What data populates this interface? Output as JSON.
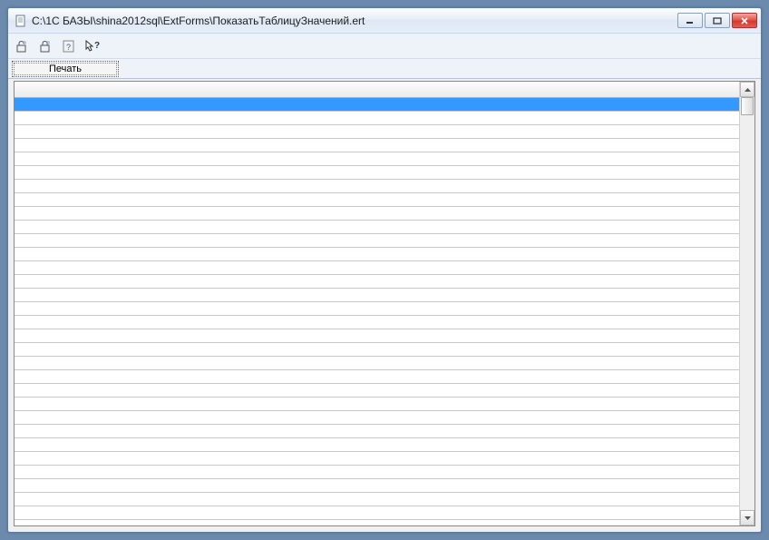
{
  "window": {
    "title": "C:\\1С БАЗЫ\\shina2012sql\\ExtForms\\ПоказатьТаблицуЗначений.ert"
  },
  "toolbar": {
    "print_label": "Печать"
  },
  "grid": {
    "row_count": 31,
    "selected_index": 0
  },
  "icons": {
    "app": "document-icon",
    "minimize": "minimize-icon",
    "maximize": "maximize-icon",
    "close": "close-icon",
    "tool1": "lock-open-icon",
    "tool2": "lock-closed-icon",
    "tool3": "help-icon",
    "tool4": "pointer-help-icon",
    "scroll_up": "chevron-up-icon",
    "scroll_down": "chevron-down-icon"
  }
}
